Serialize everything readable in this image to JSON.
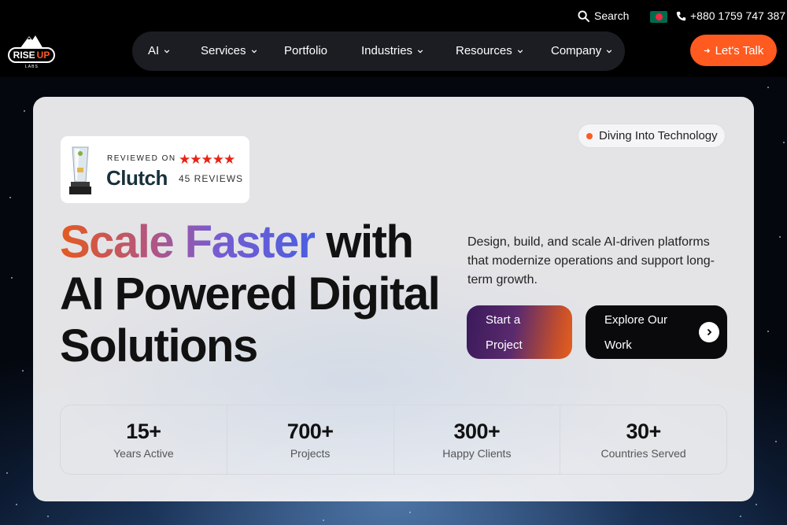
{
  "topbar": {
    "search_label": "Search",
    "phone": "+880 1759 747 387"
  },
  "logo": {
    "rise": "RISE",
    "up": "UP",
    "labs": "LABS"
  },
  "nav": {
    "items": [
      {
        "label": "AI",
        "has_dropdown": true
      },
      {
        "label": "Services",
        "has_dropdown": true
      },
      {
        "label": "Portfolio",
        "has_dropdown": false
      },
      {
        "label": "Industries",
        "has_dropdown": true
      },
      {
        "label": "Resources",
        "has_dropdown": true
      },
      {
        "label": "Company",
        "has_dropdown": true
      }
    ],
    "cta_label": "Let's Talk"
  },
  "hero": {
    "badge": {
      "reviewed_on": "REVIEWED ON",
      "brand": "Clutch",
      "stars": "★★★★★",
      "reviews": "45 REVIEWS"
    },
    "tag": "Diving Into Technology",
    "headline": {
      "gradient_part": "Scale Faster",
      "rest_line1": "with",
      "line2": "AI Powered Digital",
      "line3": "Solutions"
    },
    "description": "Design, build, and scale AI-driven platforms that modernize operations and support long-term growth.",
    "primary_button": "Start a Project",
    "secondary_button": "Explore Our Work",
    "stats": [
      {
        "value": "15+",
        "label": "Years Active"
      },
      {
        "value": "700+",
        "label": "Projects"
      },
      {
        "value": "300+",
        "label": "Happy Clients"
      },
      {
        "value": "30+",
        "label": "Countries Served"
      }
    ]
  },
  "colors": {
    "accent": "#ff5a1f",
    "nav_bg": "#1b1d22",
    "star": "#e62415"
  }
}
